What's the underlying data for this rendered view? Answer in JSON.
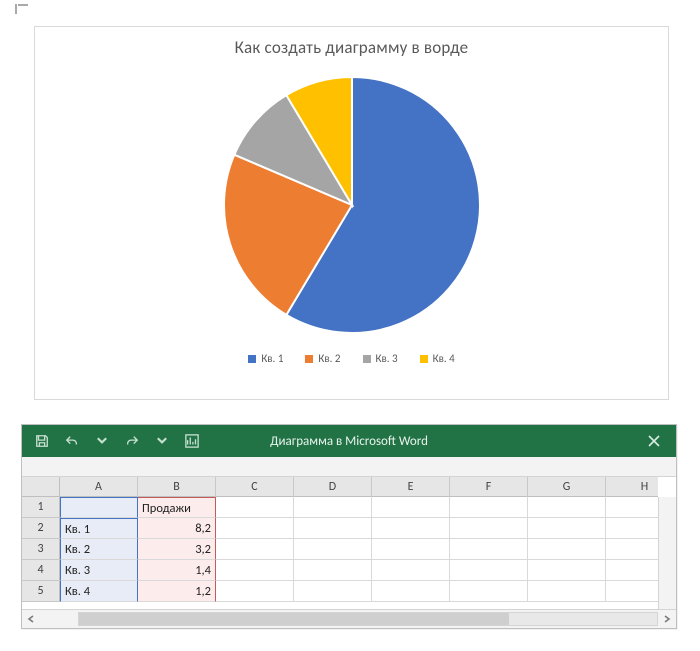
{
  "chart_data": {
    "type": "pie",
    "title": "Как создать диаграмму в ворде",
    "series": [
      {
        "name": "Кв. 1",
        "value": 8.2,
        "color": "#4472C4"
      },
      {
        "name": "Кв. 2",
        "value": 3.2,
        "color": "#ED7D31"
      },
      {
        "name": "Кв. 3",
        "value": 1.4,
        "color": "#A5A5A5"
      },
      {
        "name": "Кв. 4",
        "value": 1.2,
        "color": "#FFC000"
      }
    ]
  },
  "excel": {
    "title": "Диаграмма в Microsoft Word",
    "columns": [
      "A",
      "B",
      "C",
      "D",
      "E",
      "F",
      "G",
      "H"
    ],
    "rows": [
      "1",
      "2",
      "3",
      "4",
      "5"
    ],
    "header_cell": "Продажи",
    "data": [
      {
        "label": "Кв. 1",
        "value": "8,2"
      },
      {
        "label": "Кв. 2",
        "value": "3,2"
      },
      {
        "label": "Кв. 3",
        "value": "1,4"
      },
      {
        "label": "Кв. 4",
        "value": "1,2"
      }
    ]
  }
}
